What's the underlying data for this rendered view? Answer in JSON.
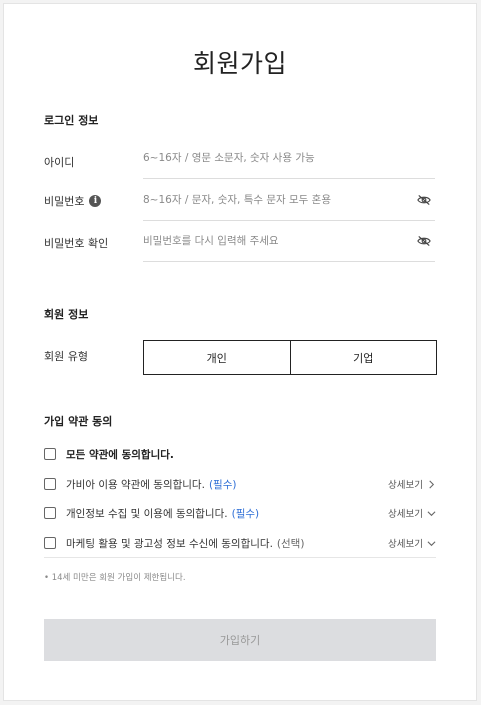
{
  "title": "회원가입",
  "login_section": {
    "heading": "로그인 정보",
    "id_label": "아이디",
    "id_placeholder": "6~16자 / 영문 소문자, 숫자 사용 가능",
    "pw_label": "비밀번호",
    "pw_info_icon": "info-icon",
    "pw_placeholder": "8~16자 / 문자, 숫자, 특수 문자 모두 혼용",
    "pw_confirm_label": "비밀번호 확인",
    "pw_confirm_placeholder": "비밀번호를 다시 입력해 주세요",
    "toggle_icon": "eye-off-icon"
  },
  "member_section": {
    "heading": "회원 정보",
    "type_label": "회원 유형",
    "options": [
      "개인",
      "기업"
    ]
  },
  "terms_section": {
    "heading": "가입 약관 동의",
    "all_label": "모든 약관에 동의합니다.",
    "items": [
      {
        "label": "가비아 이용 약관에 동의합니다.",
        "tag": "(필수)",
        "more": "상세보기",
        "icon": "chevron-right-icon"
      },
      {
        "label": "개인정보 수집 및 이용에 동의합니다.",
        "tag": "(필수)",
        "more": "상세보기",
        "icon": "chevron-down-icon"
      },
      {
        "label": "마케팅 활용 및 광고성 정보 수신에 동의합니다.",
        "tag": "(선택)",
        "more": "상세보기",
        "icon": "chevron-down-icon"
      }
    ],
    "note": "• 14세 미만은 회원 가입이 제한됩니다."
  },
  "submit_label": "가입하기",
  "colors": {
    "required": "#2f6fd6",
    "button_disabled_bg": "#dcdde0",
    "button_disabled_text": "#999999"
  }
}
